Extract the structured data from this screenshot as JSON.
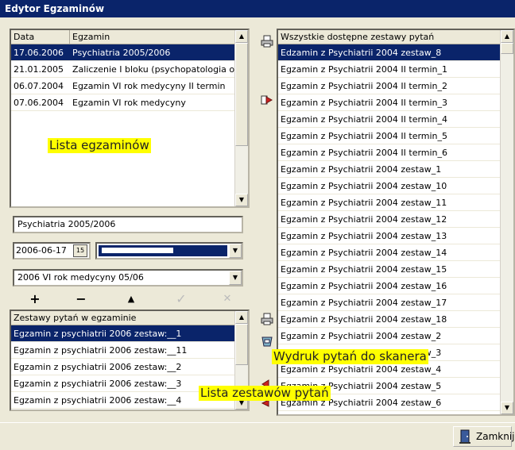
{
  "window": {
    "title": "Edytor Egzaminów"
  },
  "exams": {
    "columns": [
      "Data",
      "Egzamin"
    ],
    "rows": [
      {
        "date": "17.06.2006",
        "name": "Psychiatria 2005/2006",
        "selected": true
      },
      {
        "date": "21.01.2005",
        "name": "Zaliczenie I bloku (psychopatologia og",
        "selected": false
      },
      {
        "date": "06.07.2004",
        "name": "Egzamin VI rok medycyny II termin",
        "selected": false
      },
      {
        "date": "07.06.2004",
        "name": "Egzamin VI rok medycyny",
        "selected": false
      }
    ],
    "annotation": "Lista egzaminów"
  },
  "form": {
    "exam_name": "Psychiatria 2005/2006",
    "date": "2006-06-17",
    "calendar_label": "15",
    "group": "2006 VI rok medycyny 05/06"
  },
  "toolbar": {
    "add": "+",
    "remove": "−",
    "up": "▲",
    "confirm": "✓",
    "cancel": "✕"
  },
  "exam_sets": {
    "header": "Zestawy pytań w egzaminie",
    "rows": [
      {
        "name": "Egzamin z psychiatrii 2006 zestaw:__1",
        "selected": true
      },
      {
        "name": "Egzamin z psychiatrii 2006 zestaw:__11",
        "selected": false
      },
      {
        "name": "Egzamin z psychiatrii 2006 zestaw:__2",
        "selected": false
      },
      {
        "name": "Egzamin z psychiatrii 2006 zestaw:__3",
        "selected": false
      },
      {
        "name": "Egzamin z psychiatrii 2006 zestaw:__4",
        "selected": false
      }
    ]
  },
  "all_sets": {
    "header": "Wszystkie dostępne zestawy pytań",
    "rows": [
      {
        "name": "Edzamin z Psychiatrii 2004 zestaw_8",
        "selected": true
      },
      {
        "name": "Egzamin z Psychiatrii 2004 II termin_1",
        "selected": false
      },
      {
        "name": "Egzamin z Psychiatrii 2004 II termin_2",
        "selected": false
      },
      {
        "name": "Egzamin z Psychiatrii 2004 II termin_3",
        "selected": false
      },
      {
        "name": "Egzamin z Psychiatrii 2004 II termin_4",
        "selected": false
      },
      {
        "name": "Egzamin z Psychiatrii 2004 II termin_5",
        "selected": false
      },
      {
        "name": "Egzamin z Psychiatrii 2004 II termin_6",
        "selected": false
      },
      {
        "name": "Egzamin z Psychiatrii 2004 zestaw_1",
        "selected": false
      },
      {
        "name": "Egzamin z Psychiatrii 2004 zestaw_10",
        "selected": false
      },
      {
        "name": "Egzamin z Psychiatrii 2004 zestaw_11",
        "selected": false
      },
      {
        "name": "Egzamin z Psychiatrii 2004 zestaw_12",
        "selected": false
      },
      {
        "name": "Egzamin z Psychiatrii 2004 zestaw_13",
        "selected": false
      },
      {
        "name": "Egzamin z Psychiatrii 2004 zestaw_14",
        "selected": false
      },
      {
        "name": "Egzamin z Psychiatrii 2004 zestaw_15",
        "selected": false
      },
      {
        "name": "Egzamin z Psychiatrii 2004 zestaw_16",
        "selected": false
      },
      {
        "name": "Egzamin z Psychiatrii 2004 zestaw_17",
        "selected": false
      },
      {
        "name": "Egzamin z Psychiatrii 2004 zestaw_18",
        "selected": false
      },
      {
        "name": "Egzamin z Psychiatrii 2004 zestaw_2",
        "selected": false
      },
      {
        "name": "Egzamin z Psychiatrii 2004 zestaw_3",
        "selected": false
      },
      {
        "name": "Egzamin z Psychiatrii 2004 zestaw_4",
        "selected": false
      },
      {
        "name": "Egzamin z Psychiatrii 2004 zestaw_5",
        "selected": false
      },
      {
        "name": "Egzamin z Psychiatrii 2004 zestaw_6",
        "selected": false
      }
    ]
  },
  "annotations": {
    "print_scanner": "Wydruk pytań do skanera",
    "sets_list": "Lista zestawów pytań"
  },
  "footer": {
    "close_label": "Zamknij"
  },
  "icons": {
    "print": "printer-icon",
    "move_right": "arrow-right-icon",
    "scanner": "scanner-icon",
    "close": "door-icon"
  },
  "colors": {
    "selection": "#0a246a",
    "annotation": "#ffff00",
    "arrow": "#cc2222"
  }
}
